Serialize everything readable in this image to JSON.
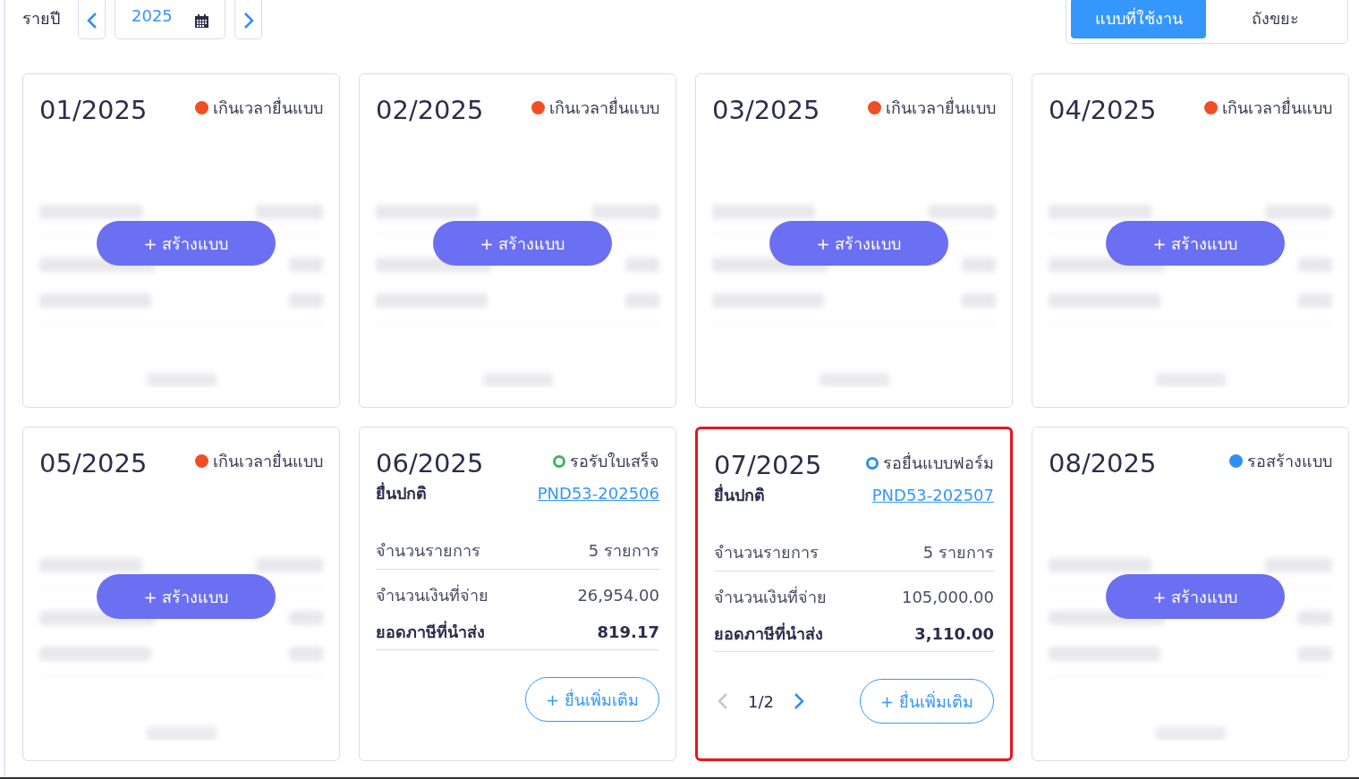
{
  "toolbar": {
    "label": "รายปี",
    "year": "2025"
  },
  "tabs": [
    {
      "label": "แบบที่ใช้งาน",
      "selected": true
    },
    {
      "label": "ถังขยะ",
      "selected": false
    }
  ],
  "cards": [
    {
      "kind": "empty",
      "period": "01/2025",
      "status": {
        "text": "เกินเวลายื่นแบบ",
        "color": "#f04e23",
        "kind": "filled"
      },
      "create_label": "+ สร้างแบบ",
      "highlighted": false
    },
    {
      "kind": "empty",
      "period": "02/2025",
      "status": {
        "text": "เกินเวลายื่นแบบ",
        "color": "#f04e23",
        "kind": "filled"
      },
      "create_label": "+ สร้างแบบ",
      "highlighted": false
    },
    {
      "kind": "empty",
      "period": "03/2025",
      "status": {
        "text": "เกินเวลายื่นแบบ",
        "color": "#f04e23",
        "kind": "filled"
      },
      "create_label": "+ สร้างแบบ",
      "highlighted": false
    },
    {
      "kind": "empty",
      "period": "04/2025",
      "status": {
        "text": "เกินเวลายื่นแบบ",
        "color": "#f04e23",
        "kind": "filled"
      },
      "create_label": "+ สร้างแบบ",
      "highlighted": false
    },
    {
      "kind": "empty",
      "period": "05/2025",
      "status": {
        "text": "เกินเวลายื่นแบบ",
        "color": "#f04e23",
        "kind": "filled"
      },
      "create_label": "+ สร้างแบบ",
      "highlighted": false
    },
    {
      "kind": "filed",
      "period": "06/2025",
      "status": {
        "text": "รอรับใบเสร็จ",
        "color": "#3cb563",
        "kind": "ring"
      },
      "filing_type": "ยื่นปกติ",
      "form_link": "PND53-202506",
      "rows": [
        {
          "label": "จำนวนรายการ",
          "value": "5 รายการ",
          "bold": false
        },
        {
          "label": "จำนวนเงินที่จ่าย",
          "value": "26,954.00",
          "bold": false
        },
        {
          "label": "ยอดภาษีที่นำส่ง",
          "value": "819.17",
          "bold": true
        }
      ],
      "add_label": "+ ยื่นเพิ่มเติม",
      "highlighted": false
    },
    {
      "kind": "filed",
      "period": "07/2025",
      "status": {
        "text": "รอยื่นแบบฟอร์ม",
        "color": "#2f8ef5",
        "kind": "ring"
      },
      "filing_type": "ยื่นปกติ",
      "form_link": "PND53-202507",
      "rows": [
        {
          "label": "จำนวนรายการ",
          "value": "5 รายการ",
          "bold": false
        },
        {
          "label": "จำนวนเงินที่จ่าย",
          "value": "105,000.00",
          "bold": false
        },
        {
          "label": "ยอดภาษีที่นำส่ง",
          "value": "3,110.00",
          "bold": true
        }
      ],
      "pager": {
        "text": "1/2",
        "prev_disabled": true,
        "next_disabled": false
      },
      "add_label": "+ ยื่นเพิ่มเติม",
      "highlighted": true
    },
    {
      "kind": "empty",
      "period": "08/2025",
      "status": {
        "text": "รอสร้างแบบ",
        "color": "#2f8ef5",
        "kind": "filled"
      },
      "create_label": "+ สร้างแบบ",
      "highlighted": false
    }
  ]
}
